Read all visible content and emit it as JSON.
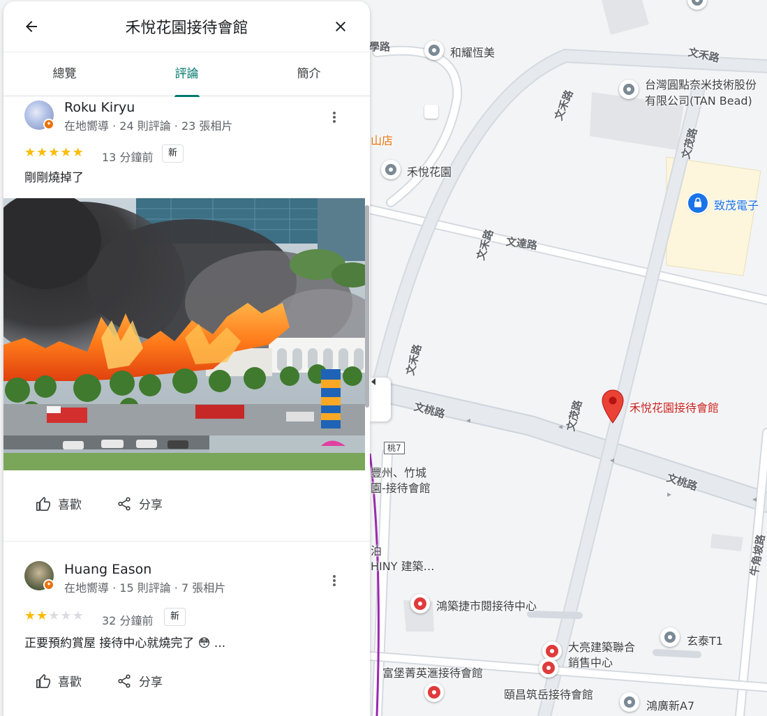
{
  "panel": {
    "title": "禾悅花園接待會館",
    "tabs": [
      {
        "label": "總覽",
        "active": false
      },
      {
        "label": "評論",
        "active": true
      },
      {
        "label": "簡介",
        "active": false
      }
    ]
  },
  "reviews": [
    {
      "name": "Roku Kiryu",
      "meta": "在地嚮導 · 24 則評論 · 23 張相片",
      "rating": 5,
      "time": "13 分鐘前",
      "badge": "新",
      "text": "剛剛燒掉了",
      "like_label": "喜歡",
      "share_label": "分享"
    },
    {
      "name": "Huang Eason",
      "meta": "在地嚮導 · 15 則評論 · 7 張相片",
      "rating": 2,
      "time": "32 分鐘前",
      "badge": "新",
      "text": "正要預約賞屋 接待中心就燒完了 😳 ...",
      "like_label": "喜歡",
      "share_label": "分享"
    }
  ],
  "map": {
    "places": {
      "hyh": "和耀恆美",
      "tanbead_1": "台灣圓點奈米技術股份",
      "tanbead_2": "有限公司(TAN Bead)",
      "shop": "山店",
      "heyue_garden": "禾悅花園",
      "zhimao": "致茂電子",
      "target": "禾悅花園接待會館",
      "fengzhou_1": "豐州、竹城",
      "fengzhou_2": "園-接待會館",
      "bo": "泊",
      "shiny": "HINY 建築…",
      "hongzhu": "鴻築捷市閱接待中心",
      "dl_1": "大亮建築聯合",
      "dl_2": "銷售中心",
      "xuantai": "玄泰T1",
      "fubao": "富堡菁英滙接待會館",
      "yichang": "頤昌筑岳接待會館",
      "hongguang": "鴻廣新A7"
    },
    "roads": {
      "wenhe_1": "文禾路",
      "wenhe_2": "文禾路",
      "wenhe_3": "文禾路",
      "wenmao_1": "文茂路",
      "wenmao_2": "文茂路",
      "wenda": "文達路",
      "wentao_1": "文桃路",
      "wentao_2": "文桃路",
      "niujiaopo": "牛角坡路",
      "xue": "學路",
      "route": "桃7"
    }
  }
}
